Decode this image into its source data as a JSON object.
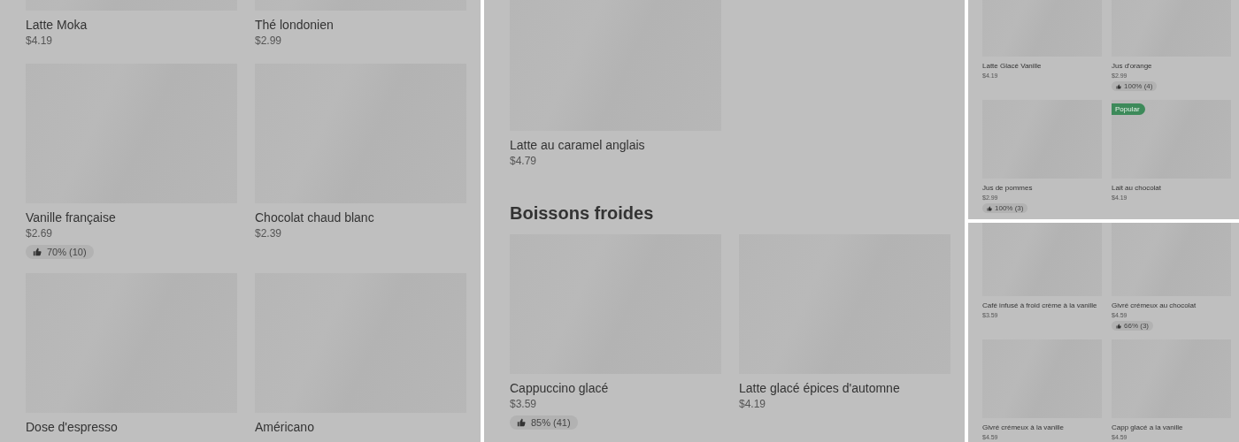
{
  "columns": [
    {
      "kind": "full",
      "panes": [
        {
          "blocks": [
            {
              "kind": "row",
              "items": [
                {
                  "name": "Latte Moka",
                  "price": "$4.19"
                },
                {
                  "name": "Thé londonien",
                  "price": "$2.99"
                }
              ]
            },
            {
              "kind": "row",
              "items": [
                {
                  "name": "Vanille française",
                  "price": "$2.69",
                  "rating": "70% (10)"
                },
                {
                  "name": "Chocolat chaud blanc",
                  "price": "$2.39"
                }
              ]
            },
            {
              "kind": "row",
              "items": [
                {
                  "name": "Dose d'espresso"
                },
                {
                  "name": "Américano"
                }
              ]
            }
          ]
        }
      ]
    },
    {
      "kind": "full",
      "panes": [
        {
          "blocks": [
            {
              "kind": "row",
              "items": [
                {
                  "name": "Latte au caramel anglais",
                  "price": "$4.79"
                }
              ]
            },
            {
              "kind": "heading",
              "text": "Boissons froides"
            },
            {
              "kind": "row",
              "items": [
                {
                  "name": "Cappuccino glacé",
                  "price": "$3.59",
                  "rating": "85% (41)"
                },
                {
                  "name": "Latte glacé épices d'automne",
                  "price": "$4.19"
                }
              ]
            }
          ]
        }
      ]
    },
    {
      "kind": "compact",
      "panes": [
        {
          "blocks": [
            {
              "kind": "row",
              "items": [
                {
                  "name": "Latte Glacé Vanille",
                  "price": "$4.19"
                },
                {
                  "name": "Jus d'orange",
                  "price": "$2.99",
                  "rating": "100% (4)"
                }
              ]
            },
            {
              "kind": "row",
              "items": [
                {
                  "name": "Jus de pommes",
                  "price": "$2.99",
                  "rating": "100% (3)"
                },
                {
                  "name": "Lait au chocolat",
                  "price": "$4.19",
                  "badge": "Popular"
                }
              ]
            }
          ]
        },
        {
          "blocks": [
            {
              "kind": "row",
              "items": [
                {
                  "name": "Café infusé à froid crème à la vanille",
                  "price": "$3.59"
                },
                {
                  "name": "Givré crémeux au chocolat",
                  "price": "$4.59",
                  "rating": "66% (3)"
                }
              ]
            },
            {
              "kind": "row",
              "items": [
                {
                  "name": "Givré crémeux à la vanille",
                  "price": "$4.59"
                },
                {
                  "name": "Capp glacé a la vanille",
                  "price": "$4.59"
                }
              ]
            }
          ]
        }
      ]
    }
  ]
}
